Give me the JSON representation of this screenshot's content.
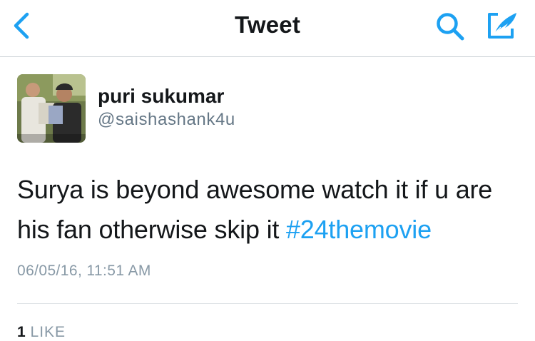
{
  "nav": {
    "title": "Tweet",
    "back_icon": "chevron-left-icon",
    "search_icon": "search-icon",
    "compose_icon": "compose-tweet-icon"
  },
  "tweet": {
    "author_name": "puri sukumar",
    "author_handle": "@saishashank4u",
    "text": "Surya is beyond awesome watch it if u are his fan otherwise skip it ",
    "hashtag": "#24themovie",
    "timestamp": "06/05/16, 11:51 AM",
    "like_count": "1",
    "like_label": "LIKE"
  },
  "colors": {
    "accent": "#1da1f2",
    "secondary_text": "#8899a6",
    "primary_text": "#14171a"
  }
}
